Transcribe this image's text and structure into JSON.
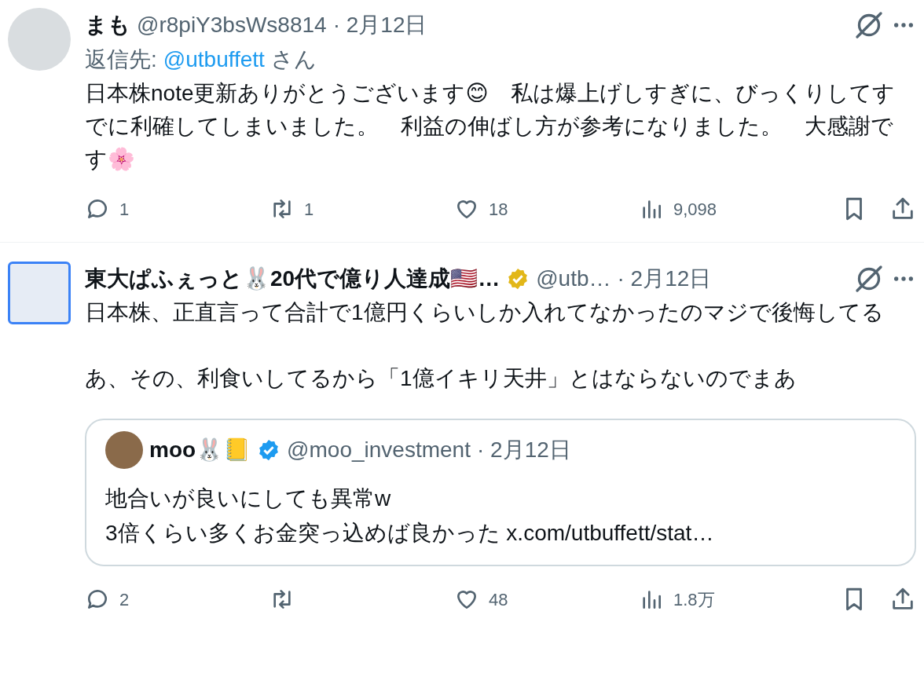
{
  "tweets": [
    {
      "author": "まも",
      "verified": false,
      "handle": "@r8piY3bsWs8814",
      "date": "· 2月12日",
      "avatar": {
        "kind": "round"
      },
      "reply_to": {
        "prefix": "返信先: ",
        "handle": "@utbuffett",
        "suffix": "さん"
      },
      "paragraphs": [
        "日本株note更新ありがとうございます😊　私は爆上げしすぎに、びっくりしてすでに利確してしまいました。　利益の伸ばし方が参考になりました。　大感謝です🌸"
      ],
      "stats": {
        "replies": "1",
        "reposts": "1",
        "likes": "18",
        "views": "9,098"
      }
    },
    {
      "author": "東大ぱふぇっと🐰20代で億り人達成🇺🇸…",
      "verified": true,
      "handle": "@utb…",
      "date": "· 2月12日",
      "avatar": {
        "kind": "square"
      },
      "paragraphs": [
        "日本株、正直言って合計で1億円くらいしか入れてなかったのマジで後悔してる",
        "あ、その、利食いしてるから「1億イキリ天井」とはならないのでまあ"
      ],
      "quote": {
        "author": "moo🐰📒",
        "verified": true,
        "handle": "@moo_investment",
        "date": "· 2月12日",
        "lines": [
          "地合いが良いにしても異常w",
          "3倍くらい多くお金突っ込めば良かった x.com/utbuffett/stat…"
        ]
      },
      "stats": {
        "replies": "2",
        "likes": "48",
        "views": "1.8万"
      }
    }
  ]
}
